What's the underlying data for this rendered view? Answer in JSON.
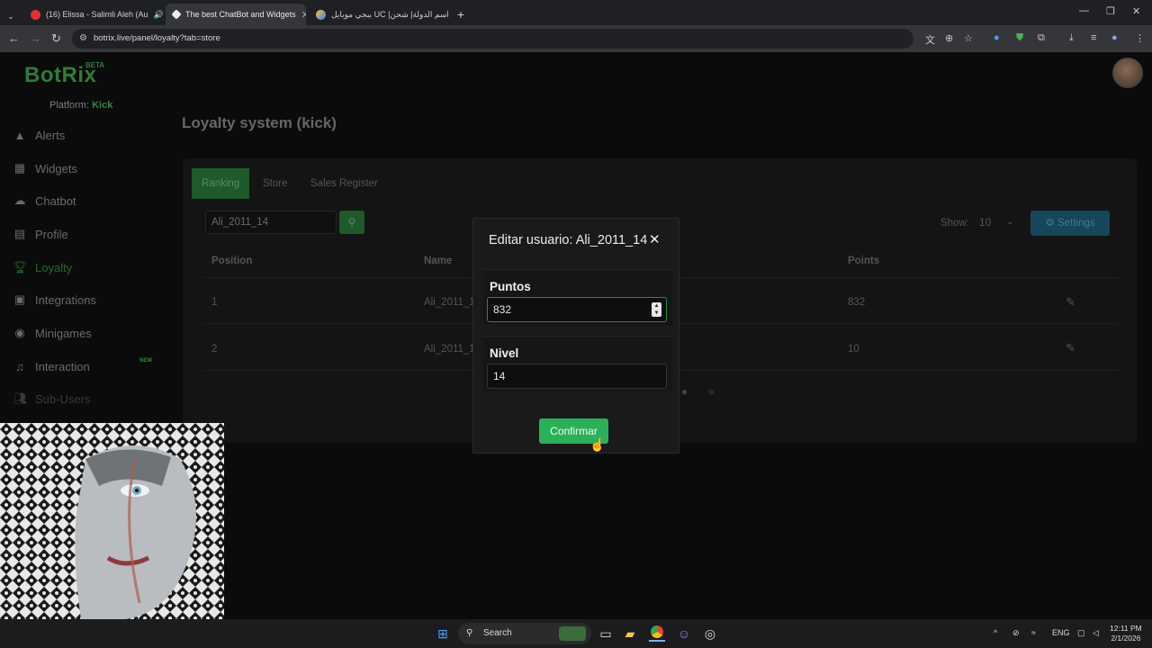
{
  "browser": {
    "tabs": [
      {
        "title": "(16) Elissa - Salimli Aleh (Au",
        "active": false
      },
      {
        "title": "The best ChatBot and Widgets",
        "active": true
      },
      {
        "title": "ببجي موبايل UC |اسم الدولة| شحن",
        "active": false
      }
    ],
    "url": "botrix.live/panel/loyalty?tab=store",
    "new_tab": "+"
  },
  "sidebar": {
    "logo": "BotRix",
    "beta": "BETA",
    "platform_label": "Platform:",
    "platform_value": "Kick",
    "items": [
      {
        "label": "Alerts",
        "icon": "warning-icon"
      },
      {
        "label": "Widgets",
        "icon": "grid-icon"
      },
      {
        "label": "Chatbot",
        "icon": "robot-icon"
      },
      {
        "label": "Profile",
        "icon": "id-card-icon"
      },
      {
        "label": "Loyalty",
        "icon": "trophy-icon",
        "active": true
      },
      {
        "label": "Integrations",
        "icon": "plug-icon"
      },
      {
        "label": "Minigames",
        "icon": "gamepad-icon"
      },
      {
        "label": "Interaction",
        "icon": "music-icon",
        "badge": "NEW"
      },
      {
        "label": "Sub-Users",
        "icon": "users-icon"
      }
    ]
  },
  "main": {
    "title": "Loyalty system (kick)",
    "tabs": [
      "Ranking",
      "Store",
      "Sales Register"
    ],
    "search_value": "Ali_2011_14",
    "show_label": "Show:",
    "show_value": "10",
    "settings_label": "Settings",
    "table": {
      "headers": [
        "Position",
        "Name",
        "Points"
      ],
      "rows": [
        {
          "position": "1",
          "name": "Ali_2011_1",
          "points": "832"
        },
        {
          "position": "2",
          "name": "Ali_2011_1",
          "points": "10"
        }
      ]
    },
    "pager_next": "»"
  },
  "modal": {
    "title": "Editar usuario: Ali_2011_14",
    "close": "✕",
    "points_label": "Puntos",
    "points_value": "832",
    "level_label": "Nivel",
    "level_value": "14",
    "confirm_label": "Confirmar"
  },
  "taskbar": {
    "search_label": "Search",
    "language": "ENG",
    "time": "12:11 PM",
    "date": "2/1/2026"
  },
  "colors": {
    "accent_green": "#2bb05a",
    "active_tab_green": "#1e5a2b",
    "settings_blue": "#16465a"
  }
}
